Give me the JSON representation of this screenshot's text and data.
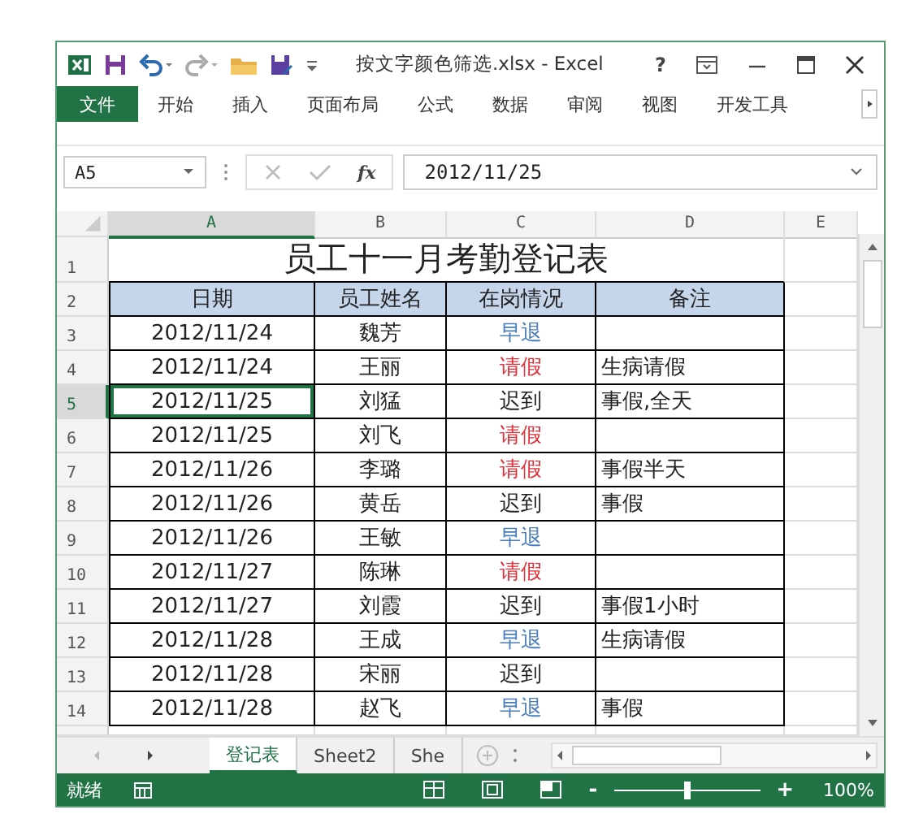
{
  "title_bar": {
    "title": "按文字颜色筛选.xlsx - Excel",
    "help": "?"
  },
  "ribbon_tabs": [
    {
      "label": "文件",
      "selected": true
    },
    {
      "label": "开始",
      "selected": false
    },
    {
      "label": "插入",
      "selected": false
    },
    {
      "label": "页面布局",
      "selected": false
    },
    {
      "label": "公式",
      "selected": false
    },
    {
      "label": "数据",
      "selected": false
    },
    {
      "label": "审阅",
      "selected": false
    },
    {
      "label": "视图",
      "selected": false
    },
    {
      "label": "开发工具",
      "selected": false
    }
  ],
  "formula_bar": {
    "name_box": "A5",
    "function_label": "fx",
    "value": "2012/11/25"
  },
  "columns": [
    {
      "label": "A",
      "selected": true
    },
    {
      "label": "B",
      "selected": false
    },
    {
      "label": "C",
      "selected": false
    },
    {
      "label": "D",
      "selected": false
    },
    {
      "label": "E",
      "selected": false
    }
  ],
  "sheet": {
    "title_row_number": "1",
    "title": "员工十一月考勤登记表",
    "header_row_number": "2",
    "headers": [
      "日期",
      "员工姓名",
      "在岗情况",
      "备注"
    ],
    "rows": [
      {
        "number": "3",
        "date": "2012/11/24",
        "name": "魏芳",
        "status": "早退",
        "color": "#4a7ebb",
        "note": "",
        "selected": false
      },
      {
        "number": "4",
        "date": "2012/11/24",
        "name": "王丽",
        "status": "请假",
        "color": "#e0303a",
        "note": "生病请假",
        "selected": false
      },
      {
        "number": "5",
        "date": "2012/11/25",
        "name": "刘猛",
        "status": "迟到",
        "color": "#222222",
        "note": "事假,全天",
        "selected": true
      },
      {
        "number": "6",
        "date": "2012/11/25",
        "name": "刘飞",
        "status": "请假",
        "color": "#e0303a",
        "note": "",
        "selected": false
      },
      {
        "number": "7",
        "date": "2012/11/26",
        "name": "李璐",
        "status": "请假",
        "color": "#e0303a",
        "note": "事假半天",
        "selected": false
      },
      {
        "number": "8",
        "date": "2012/11/26",
        "name": "黄岳",
        "status": "迟到",
        "color": "#222222",
        "note": "事假",
        "selected": false
      },
      {
        "number": "9",
        "date": "2012/11/26",
        "name": "王敏",
        "status": "早退",
        "color": "#4a7ebb",
        "note": "",
        "selected": false
      },
      {
        "number": "10",
        "date": "2012/11/27",
        "name": "陈琳",
        "status": "请假",
        "color": "#e0303a",
        "note": "",
        "selected": false
      },
      {
        "number": "11",
        "date": "2012/11/27",
        "name": "刘霞",
        "status": "迟到",
        "color": "#222222",
        "note": "事假1小时",
        "selected": false
      },
      {
        "number": "12",
        "date": "2012/11/28",
        "name": "王成",
        "status": "早退",
        "color": "#4a7ebb",
        "note": "生病请假",
        "selected": false
      },
      {
        "number": "13",
        "date": "2012/11/28",
        "name": "宋丽",
        "status": "迟到",
        "color": "#222222",
        "note": "",
        "selected": false
      },
      {
        "number": "14",
        "date": "2012/11/28",
        "name": "赵飞",
        "status": "早退",
        "color": "#4a7ebb",
        "note": "事假",
        "selected": false
      }
    ]
  },
  "sheet_tabs": [
    {
      "label": "登记表",
      "selected": true
    },
    {
      "label": "Sheet2",
      "selected": false
    },
    {
      "label": "She",
      "selected": false
    }
  ],
  "status_bar": {
    "status": "就绪",
    "zoom_out": "-",
    "zoom_in": "+",
    "zoom": {
      "level": 0.5,
      "reading": "100%"
    }
  }
}
